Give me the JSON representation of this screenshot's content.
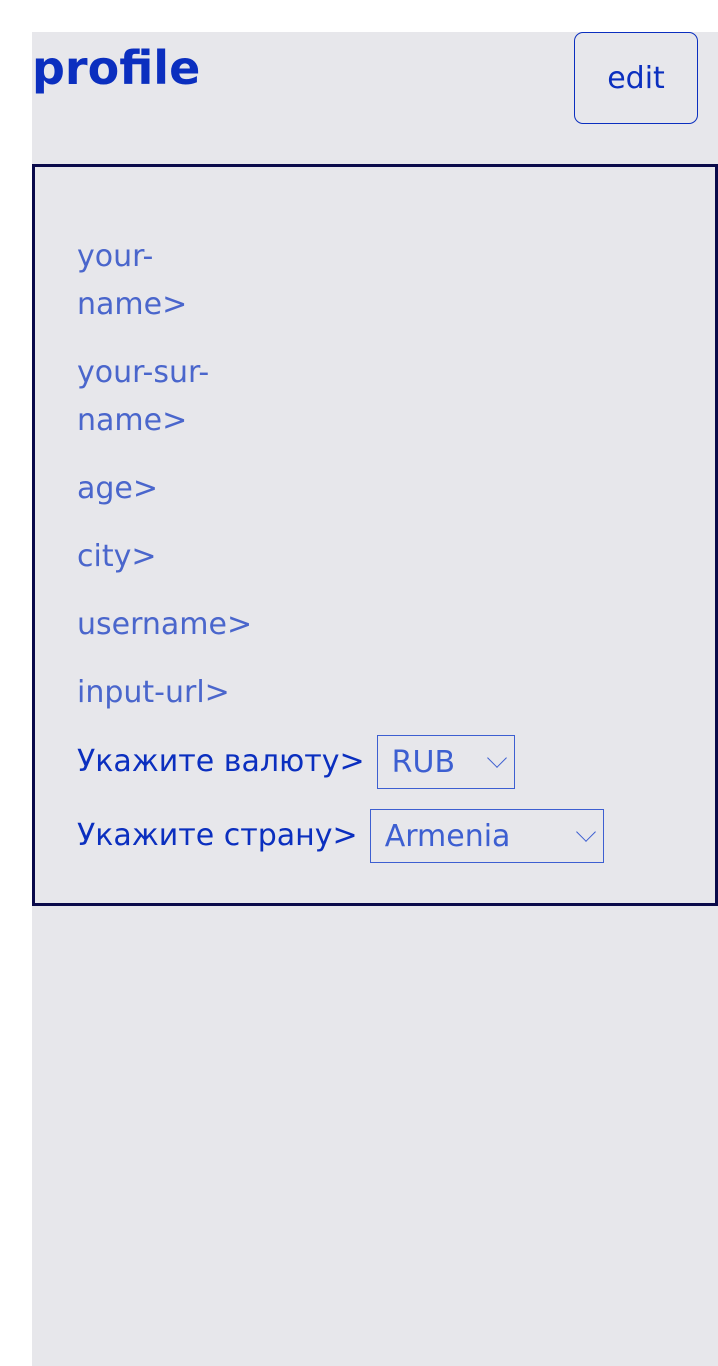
{
  "header": {
    "title": "profile",
    "edit_label": "edit"
  },
  "fields": {
    "name": [
      "your-",
      "name>"
    ],
    "surname": [
      "your-sur-",
      "name>"
    ],
    "age": "age>",
    "city": "city>",
    "username": "username>",
    "url": "input-url>"
  },
  "currency": {
    "label": "Укажите валюту>",
    "selected": "RUB"
  },
  "country": {
    "label": "Укажите страну>",
    "selected": "Armenia"
  },
  "colors": {
    "accent": "#0b2fbf",
    "field_text": "#4a66cc",
    "card_border": "#0a0a4a",
    "background": "#e7e7eb"
  }
}
